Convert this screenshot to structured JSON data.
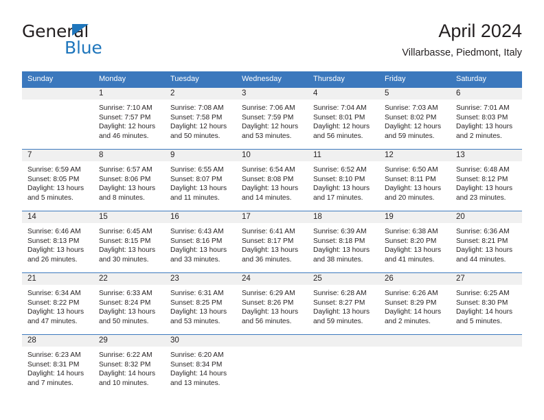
{
  "logo": {
    "word1": "General",
    "word2": "Blue",
    "accent_color": "#1f76bc"
  },
  "header": {
    "title": "April 2024",
    "subtitle": "Villarbasse, Piedmont, Italy"
  },
  "theme": {
    "header_bg": "#3b78bd",
    "daynum_bg": "#f0f0f0",
    "text": "#231f20"
  },
  "calendar": {
    "day_headers": [
      "Sunday",
      "Monday",
      "Tuesday",
      "Wednesday",
      "Thursday",
      "Friday",
      "Saturday"
    ],
    "weeks": [
      [
        {
          "day": "",
          "blank": true
        },
        {
          "day": "1",
          "sunrise": "Sunrise: 7:10 AM",
          "sunset": "Sunset: 7:57 PM",
          "daylight1": "Daylight: 12 hours",
          "daylight2": "and 46 minutes."
        },
        {
          "day": "2",
          "sunrise": "Sunrise: 7:08 AM",
          "sunset": "Sunset: 7:58 PM",
          "daylight1": "Daylight: 12 hours",
          "daylight2": "and 50 minutes."
        },
        {
          "day": "3",
          "sunrise": "Sunrise: 7:06 AM",
          "sunset": "Sunset: 7:59 PM",
          "daylight1": "Daylight: 12 hours",
          "daylight2": "and 53 minutes."
        },
        {
          "day": "4",
          "sunrise": "Sunrise: 7:04 AM",
          "sunset": "Sunset: 8:01 PM",
          "daylight1": "Daylight: 12 hours",
          "daylight2": "and 56 minutes."
        },
        {
          "day": "5",
          "sunrise": "Sunrise: 7:03 AM",
          "sunset": "Sunset: 8:02 PM",
          "daylight1": "Daylight: 12 hours",
          "daylight2": "and 59 minutes."
        },
        {
          "day": "6",
          "sunrise": "Sunrise: 7:01 AM",
          "sunset": "Sunset: 8:03 PM",
          "daylight1": "Daylight: 13 hours",
          "daylight2": "and 2 minutes."
        }
      ],
      [
        {
          "day": "7",
          "sunrise": "Sunrise: 6:59 AM",
          "sunset": "Sunset: 8:05 PM",
          "daylight1": "Daylight: 13 hours",
          "daylight2": "and 5 minutes."
        },
        {
          "day": "8",
          "sunrise": "Sunrise: 6:57 AM",
          "sunset": "Sunset: 8:06 PM",
          "daylight1": "Daylight: 13 hours",
          "daylight2": "and 8 minutes."
        },
        {
          "day": "9",
          "sunrise": "Sunrise: 6:55 AM",
          "sunset": "Sunset: 8:07 PM",
          "daylight1": "Daylight: 13 hours",
          "daylight2": "and 11 minutes."
        },
        {
          "day": "10",
          "sunrise": "Sunrise: 6:54 AM",
          "sunset": "Sunset: 8:08 PM",
          "daylight1": "Daylight: 13 hours",
          "daylight2": "and 14 minutes."
        },
        {
          "day": "11",
          "sunrise": "Sunrise: 6:52 AM",
          "sunset": "Sunset: 8:10 PM",
          "daylight1": "Daylight: 13 hours",
          "daylight2": "and 17 minutes."
        },
        {
          "day": "12",
          "sunrise": "Sunrise: 6:50 AM",
          "sunset": "Sunset: 8:11 PM",
          "daylight1": "Daylight: 13 hours",
          "daylight2": "and 20 minutes."
        },
        {
          "day": "13",
          "sunrise": "Sunrise: 6:48 AM",
          "sunset": "Sunset: 8:12 PM",
          "daylight1": "Daylight: 13 hours",
          "daylight2": "and 23 minutes."
        }
      ],
      [
        {
          "day": "14",
          "sunrise": "Sunrise: 6:46 AM",
          "sunset": "Sunset: 8:13 PM",
          "daylight1": "Daylight: 13 hours",
          "daylight2": "and 26 minutes."
        },
        {
          "day": "15",
          "sunrise": "Sunrise: 6:45 AM",
          "sunset": "Sunset: 8:15 PM",
          "daylight1": "Daylight: 13 hours",
          "daylight2": "and 30 minutes."
        },
        {
          "day": "16",
          "sunrise": "Sunrise: 6:43 AM",
          "sunset": "Sunset: 8:16 PM",
          "daylight1": "Daylight: 13 hours",
          "daylight2": "and 33 minutes."
        },
        {
          "day": "17",
          "sunrise": "Sunrise: 6:41 AM",
          "sunset": "Sunset: 8:17 PM",
          "daylight1": "Daylight: 13 hours",
          "daylight2": "and 36 minutes."
        },
        {
          "day": "18",
          "sunrise": "Sunrise: 6:39 AM",
          "sunset": "Sunset: 8:18 PM",
          "daylight1": "Daylight: 13 hours",
          "daylight2": "and 38 minutes."
        },
        {
          "day": "19",
          "sunrise": "Sunrise: 6:38 AM",
          "sunset": "Sunset: 8:20 PM",
          "daylight1": "Daylight: 13 hours",
          "daylight2": "and 41 minutes."
        },
        {
          "day": "20",
          "sunrise": "Sunrise: 6:36 AM",
          "sunset": "Sunset: 8:21 PM",
          "daylight1": "Daylight: 13 hours",
          "daylight2": "and 44 minutes."
        }
      ],
      [
        {
          "day": "21",
          "sunrise": "Sunrise: 6:34 AM",
          "sunset": "Sunset: 8:22 PM",
          "daylight1": "Daylight: 13 hours",
          "daylight2": "and 47 minutes."
        },
        {
          "day": "22",
          "sunrise": "Sunrise: 6:33 AM",
          "sunset": "Sunset: 8:24 PM",
          "daylight1": "Daylight: 13 hours",
          "daylight2": "and 50 minutes."
        },
        {
          "day": "23",
          "sunrise": "Sunrise: 6:31 AM",
          "sunset": "Sunset: 8:25 PM",
          "daylight1": "Daylight: 13 hours",
          "daylight2": "and 53 minutes."
        },
        {
          "day": "24",
          "sunrise": "Sunrise: 6:29 AM",
          "sunset": "Sunset: 8:26 PM",
          "daylight1": "Daylight: 13 hours",
          "daylight2": "and 56 minutes."
        },
        {
          "day": "25",
          "sunrise": "Sunrise: 6:28 AM",
          "sunset": "Sunset: 8:27 PM",
          "daylight1": "Daylight: 13 hours",
          "daylight2": "and 59 minutes."
        },
        {
          "day": "26",
          "sunrise": "Sunrise: 6:26 AM",
          "sunset": "Sunset: 8:29 PM",
          "daylight1": "Daylight: 14 hours",
          "daylight2": "and 2 minutes."
        },
        {
          "day": "27",
          "sunrise": "Sunrise: 6:25 AM",
          "sunset": "Sunset: 8:30 PM",
          "daylight1": "Daylight: 14 hours",
          "daylight2": "and 5 minutes."
        }
      ],
      [
        {
          "day": "28",
          "sunrise": "Sunrise: 6:23 AM",
          "sunset": "Sunset: 8:31 PM",
          "daylight1": "Daylight: 14 hours",
          "daylight2": "and 7 minutes."
        },
        {
          "day": "29",
          "sunrise": "Sunrise: 6:22 AM",
          "sunset": "Sunset: 8:32 PM",
          "daylight1": "Daylight: 14 hours",
          "daylight2": "and 10 minutes."
        },
        {
          "day": "30",
          "sunrise": "Sunrise: 6:20 AM",
          "sunset": "Sunset: 8:34 PM",
          "daylight1": "Daylight: 14 hours",
          "daylight2": "and 13 minutes."
        },
        {
          "day": "",
          "blank": true
        },
        {
          "day": "",
          "blank": true
        },
        {
          "day": "",
          "blank": true
        },
        {
          "day": "",
          "blank": true
        }
      ]
    ]
  }
}
